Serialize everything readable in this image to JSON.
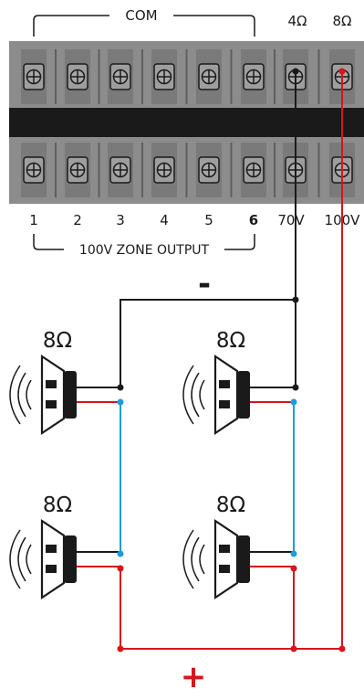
{
  "header": {
    "com_label": "COM",
    "ohm4_label": "4Ω",
    "ohm8_label": "8Ω"
  },
  "terminal_labels": [
    "1",
    "2",
    "3",
    "4",
    "5",
    "6",
    "70V",
    "100V"
  ],
  "zone_output_label": "100V ZONE OUTPUT",
  "polarity": {
    "negative": "-",
    "positive": "+"
  },
  "speakers": [
    {
      "impedance": "8Ω"
    },
    {
      "impedance": "8Ω"
    },
    {
      "impedance": "8Ω"
    },
    {
      "impedance": "8Ω"
    }
  ],
  "colors": {
    "negative_wire": "#1a1a1a",
    "positive_wire": "#d9141b",
    "bridge_wire": "#1a9fd8",
    "terminal_block": "#8c8c8c",
    "terminal_divider": "#1a1a1a"
  }
}
